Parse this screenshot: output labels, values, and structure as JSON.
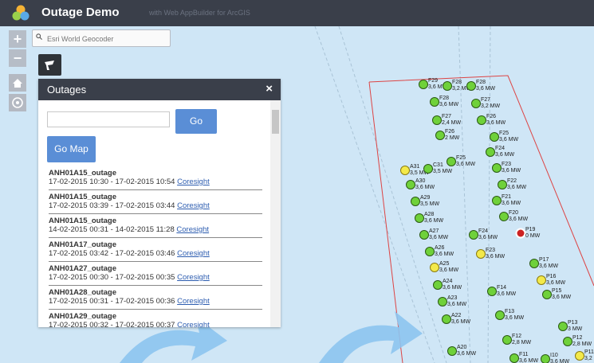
{
  "header": {
    "title": "Outage Demo",
    "subtitle": "with Web AppBuilder for ArcGIS"
  },
  "search": {
    "placeholder": "Esri World Geocoder"
  },
  "zoom": {
    "in": "+",
    "out": "−"
  },
  "panel": {
    "title": "Outages",
    "close": "×",
    "go_label": "Go",
    "gomap_label": "Go Map",
    "items": [
      {
        "name": "ANH01A15_outage",
        "dates": "17-02-2015 10:30 - 17-02-2015 10:54",
        "link": "Coresight"
      },
      {
        "name": "ANH01A15_outage",
        "dates": "17-02-2015 03:39 - 17-02-2015 03:44",
        "link": "Coresight"
      },
      {
        "name": "ANH01A15_outage",
        "dates": "14-02-2015 00:31 - 14-02-2015 11:28",
        "link": "Coresight"
      },
      {
        "name": "ANH01A17_outage",
        "dates": "17-02-2015 03:42 - 17-02-2015 03:46",
        "link": "Coresight"
      },
      {
        "name": "ANH01A27_outage",
        "dates": "17-02-2015 00:30 - 17-02-2015 00:35",
        "link": "Coresight"
      },
      {
        "name": "ANH01A28_outage",
        "dates": "17-02-2015 00:31 - 17-02-2015 00:36",
        "link": "Coresight"
      },
      {
        "name": "ANH01A29_outage",
        "dates": "17-02-2015 00:32 - 17-02-2015 00:37",
        "link": "Coresight"
      }
    ]
  },
  "turbines": [
    {
      "id": "F29",
      "output": "3,6 MW",
      "status": "green"
    },
    {
      "id": "F28",
      "output": "3,2 MW",
      "status": "green"
    },
    {
      "id": "F28",
      "output": "3,6 MW",
      "status": "green"
    },
    {
      "id": "F28",
      "output": "3,6 MW",
      "status": "green"
    },
    {
      "id": "F27",
      "output": "3,2 MW",
      "status": "green"
    },
    {
      "id": "F27",
      "output": "2,4 MW",
      "status": "green"
    },
    {
      "id": "F26",
      "output": "3,6 MW",
      "status": "green"
    },
    {
      "id": "F26",
      "output": "2 MW",
      "status": "green"
    },
    {
      "id": "F25",
      "output": "3,6 MW",
      "status": "green"
    },
    {
      "id": "F24",
      "output": "3,6 MW",
      "status": "green"
    },
    {
      "id": "F25",
      "output": "3,6 MW",
      "status": "green"
    },
    {
      "id": "A31",
      "output": "3,5 MW",
      "status": "yellow"
    },
    {
      "id": "C31",
      "output": "3,5 MW",
      "status": "green"
    },
    {
      "id": "F23",
      "output": "3,6 MW",
      "status": "green"
    },
    {
      "id": "A30",
      "output": "3,6 MW",
      "status": "green"
    },
    {
      "id": "F22",
      "output": "3,6 MW",
      "status": "green"
    },
    {
      "id": "A29",
      "output": "3,5 MW",
      "status": "green"
    },
    {
      "id": "F21",
      "output": "3,6 MW",
      "status": "green"
    },
    {
      "id": "A28",
      "output": "3,6 MW",
      "status": "green"
    },
    {
      "id": "F20",
      "output": "3,6 MW",
      "status": "green"
    },
    {
      "id": "P19",
      "output": "0 MW",
      "status": "red"
    },
    {
      "id": "A27",
      "output": "3,6 MW",
      "status": "green"
    },
    {
      "id": "F24",
      "output": "3,6 MW",
      "status": "green"
    },
    {
      "id": "A26",
      "output": "3,6 MW",
      "status": "green"
    },
    {
      "id": "F23",
      "output": "3,6 MW",
      "status": "yellow"
    },
    {
      "id": "A25",
      "output": "3,6 MW",
      "status": "yellow"
    },
    {
      "id": "P17",
      "output": "3,6 MW",
      "status": "green"
    },
    {
      "id": "A24",
      "output": "3,6 MW",
      "status": "green"
    },
    {
      "id": "P16",
      "output": "3,6 MW",
      "status": "yellow"
    },
    {
      "id": "F14",
      "output": "3,6 MW",
      "status": "green"
    },
    {
      "id": "P15",
      "output": "3,6 MW",
      "status": "green"
    },
    {
      "id": "A23",
      "output": "3,6 MW",
      "status": "green"
    },
    {
      "id": "F13",
      "output": "3,6 MW",
      "status": "green"
    },
    {
      "id": "A22",
      "output": "3,6 MW",
      "status": "green"
    },
    {
      "id": "P13",
      "output": "3 MW",
      "status": "green"
    },
    {
      "id": "F12",
      "output": "2,8 MW",
      "status": "green"
    },
    {
      "id": "P12",
      "output": "2,8 MW",
      "status": "green"
    },
    {
      "id": "A20",
      "output": "3,6 MW",
      "status": "green"
    },
    {
      "id": "F11",
      "output": "3,6 MW",
      "status": "green"
    },
    {
      "id": "I10",
      "output": "3,6 MW",
      "status": "green"
    },
    {
      "id": "P11",
      "output": "3,2 MW",
      "status": "yellow"
    }
  ],
  "colors": {
    "green": "#6fd13a",
    "yellow": "#f3e94a",
    "red": "#cc2222",
    "accent": "#5a8ed6",
    "header": "#3a3f4a"
  }
}
